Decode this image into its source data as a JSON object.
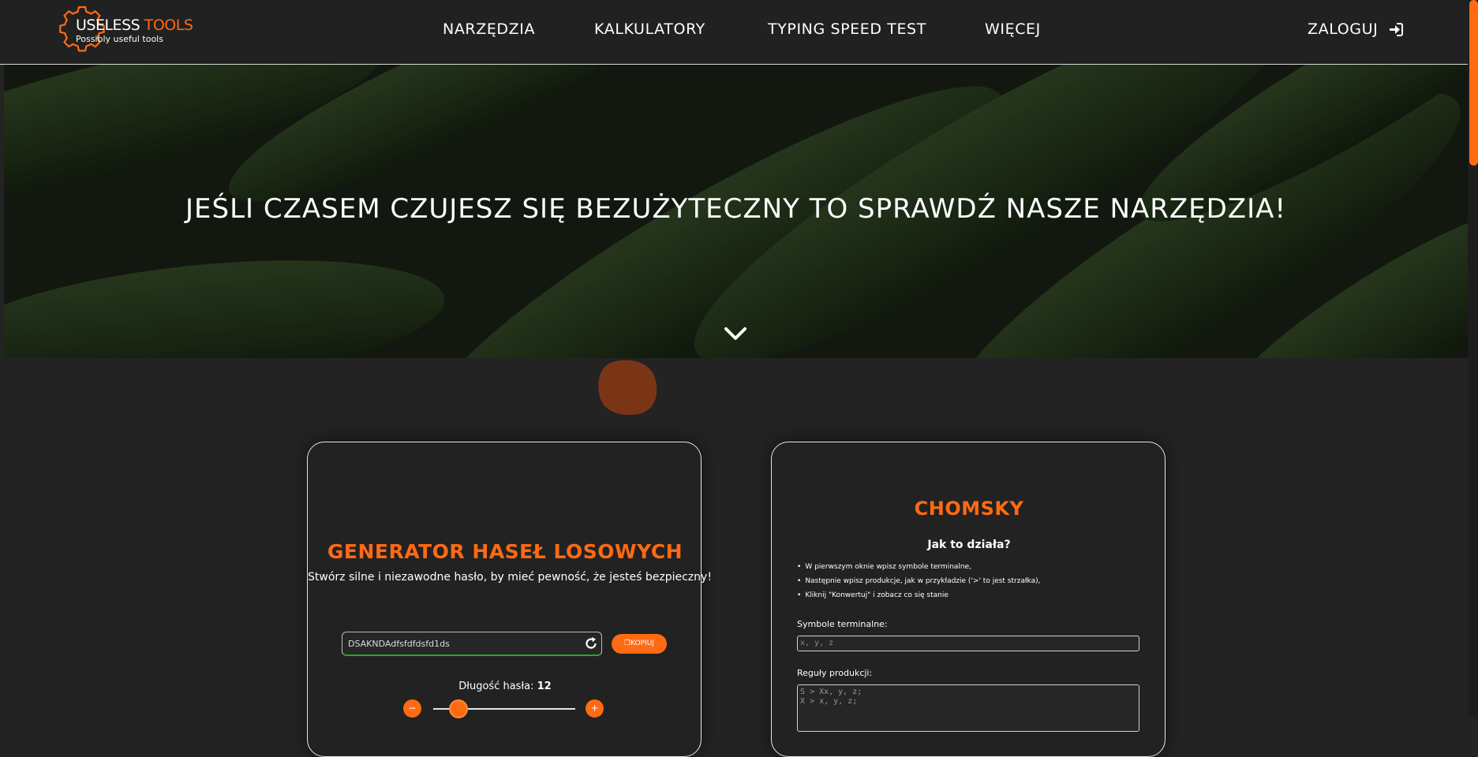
{
  "header": {
    "logo": {
      "title_main": "USELESS ",
      "title_accent": "TOOLS",
      "subtitle": "Possibly useful tools",
      "icon": "gear-icon"
    },
    "nav": [
      {
        "label": "NARZĘDZIA"
      },
      {
        "label": "KALKULATORY"
      },
      {
        "label": "TYPING SPEED TEST"
      },
      {
        "label": "WIĘCEJ"
      }
    ],
    "login": {
      "label": "ZALOGUJ",
      "icon": "sign-in-icon"
    }
  },
  "hero": {
    "title": "JEŚLI CZASEM CZUJESZ SIĘ BEZUŻYTECZNY TO SPRAWDŹ NASZE NARZĘDZIA!",
    "scroll_icon": "chevron-down-icon"
  },
  "password_card": {
    "title": "GENERATOR HASEŁ LOSOWYCH",
    "subtitle": "Stwórz silne i niezawodne hasło, by mieć pewność, że jesteś bezpieczny!",
    "password_value": "DSAKNDAdfsfdfdsfd1ds",
    "copy_label": "KOPIUJ",
    "length_label": "Długość hasła: ",
    "length_value": "12",
    "minus_label": "−",
    "plus_label": "+",
    "slider_fraction": 0.18
  },
  "chomsky_card": {
    "title": "CHOMSKY",
    "how_title": "Jak to działa?",
    "steps": [
      "W pierwszym oknie wpisz symbole terminalne,",
      "Następnie wpisz produkcje, jak w przykładzie ('>' to jest strzałka),",
      "Kliknij \"Konwertuj\" i zobacz co się stanie"
    ],
    "terminals_label": "Symbole terminalne:",
    "terminals_placeholder": "x, y, z",
    "rules_label": "Reguły produkcji:",
    "rules_placeholder": "S > Xx, y, z;\nX > x, y, z;"
  },
  "colors": {
    "accent": "#ff6a13",
    "background": "#232323",
    "header": "#212121"
  }
}
